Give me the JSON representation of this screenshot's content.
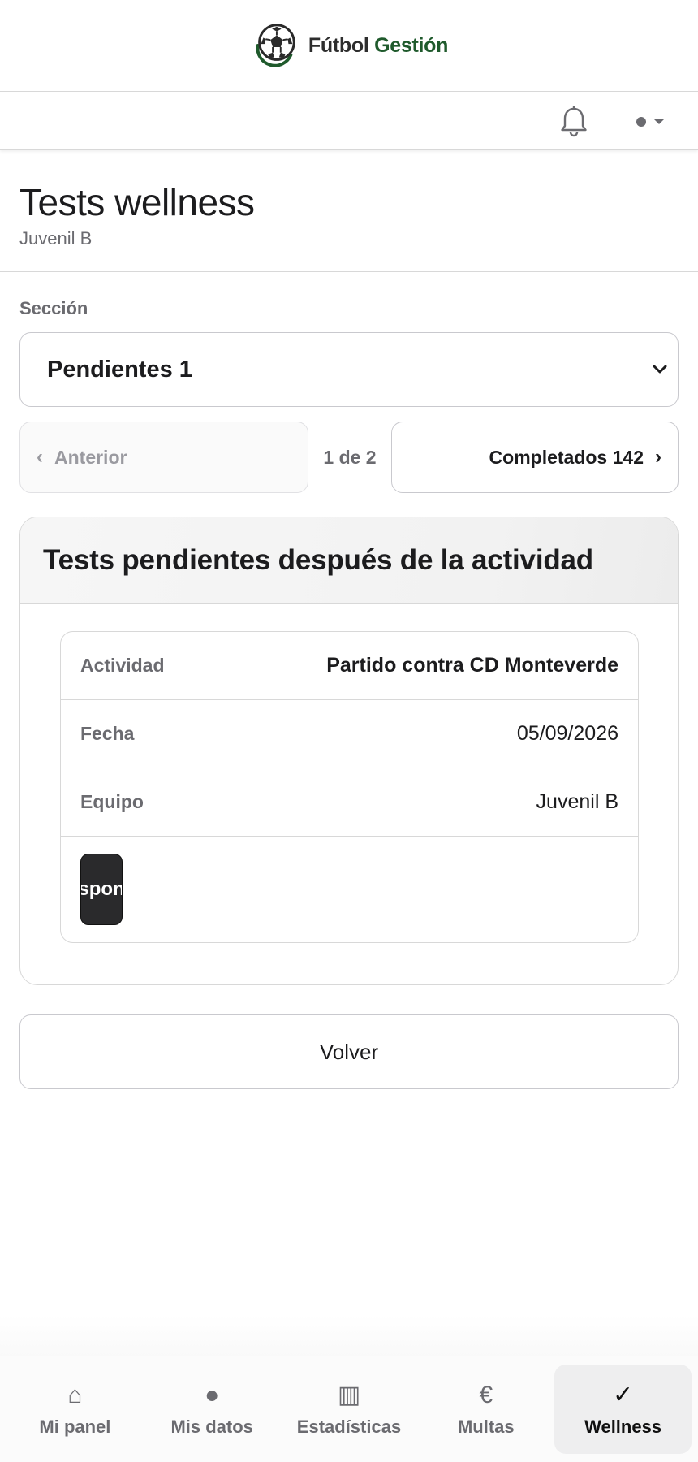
{
  "brand": {
    "name_part1": "Fútbol",
    "name_part2": "Gestión"
  },
  "topbar": {
    "notifications_icon": "bell-icon",
    "user_menu_icon": "user-dot-icon"
  },
  "header": {
    "title": "Tests wellness",
    "subtitle": "Juvenil B"
  },
  "section": {
    "label": "Sección",
    "selected": "Pendientes 1"
  },
  "pager": {
    "prev_arrow": "‹",
    "prev_label": "Anterior",
    "count": "1 de 2",
    "next_label": "Completados 142",
    "next_arrow": "›"
  },
  "card": {
    "title": "Tests pendientes después de la actividad",
    "rows": [
      {
        "label": "Actividad",
        "value": "Partido contra CD Monteverde"
      },
      {
        "label": "Fecha",
        "value": "05/09/2026"
      },
      {
        "label": "Equipo",
        "value": "Juvenil B"
      }
    ],
    "action_label": "spon"
  },
  "back_button": "Volver",
  "bottom_nav": [
    {
      "icon": "⌂",
      "label": "Mi panel",
      "active": false
    },
    {
      "icon": "●",
      "label": "Mis datos",
      "active": false
    },
    {
      "icon": "▥",
      "label": "Estadísticas",
      "active": false
    },
    {
      "icon": "€",
      "label": "Multas",
      "active": false
    },
    {
      "icon": "✓",
      "label": "Wellness",
      "active": true
    }
  ],
  "colors": {
    "brand_green": "#1f5a2c",
    "muted": "#6b6b70",
    "text": "#1c1c1e"
  }
}
